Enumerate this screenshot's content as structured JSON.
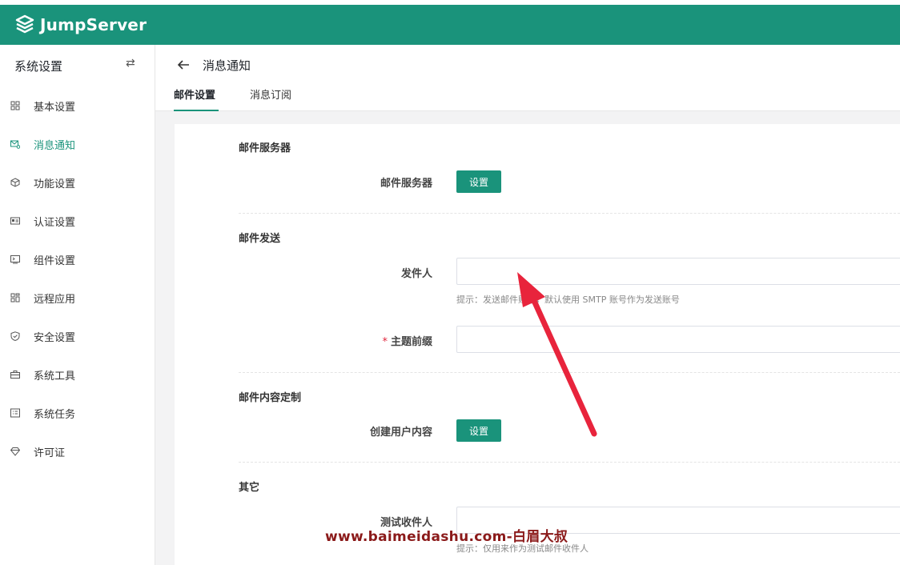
{
  "app": {
    "logo_text": "JumpServer",
    "brand_color": "#1a937b"
  },
  "sidebar": {
    "title": "系统设置",
    "items": [
      {
        "label": "基本设置",
        "icon": "grid-icon"
      },
      {
        "label": "消息通知",
        "icon": "mail-settings-icon",
        "active": true
      },
      {
        "label": "功能设置",
        "icon": "cube-icon"
      },
      {
        "label": "认证设置",
        "icon": "id-card-icon"
      },
      {
        "label": "组件设置",
        "icon": "terminal-icon"
      },
      {
        "label": "远程应用",
        "icon": "apps-icon"
      },
      {
        "label": "安全设置",
        "icon": "shield-icon"
      },
      {
        "label": "系统工具",
        "icon": "toolbox-icon"
      },
      {
        "label": "系统任务",
        "icon": "task-icon"
      },
      {
        "label": "许可证",
        "icon": "diamond-icon"
      }
    ]
  },
  "page": {
    "title": "消息通知",
    "tabs": [
      {
        "label": "邮件设置",
        "active": true
      },
      {
        "label": "消息订阅"
      }
    ]
  },
  "form": {
    "mail_server_section": "邮件服务器",
    "mail_server_label": "邮件服务器",
    "mail_server_button": "设置",
    "send_section": "邮件发送",
    "sender_label": "发件人",
    "sender_value": "",
    "sender_hint": "提示：发送邮件账号，默认使用 SMTP 账号作为发送账号",
    "subject_prefix_required": "*",
    "subject_prefix_label": "主题前缀",
    "subject_prefix_value": "",
    "content_section": "邮件内容定制",
    "create_user_label": "创建用户内容",
    "create_user_button": "设置",
    "other_section": "其它",
    "test_recipient_label": "测试收件人",
    "test_recipient_value": "",
    "test_recipient_hint": "提示：仅用来作为测试邮件收件人"
  },
  "overlay": {
    "watermark": "www.baimeidashu.com-白眉大叔",
    "arrow_color": "#e8243c"
  }
}
